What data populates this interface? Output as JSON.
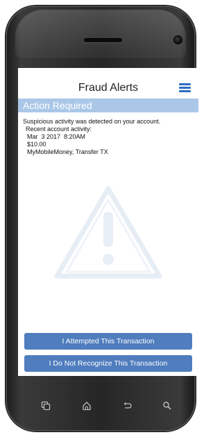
{
  "header": {
    "title": "Fraud Alerts",
    "menu_icon": "hamburger-menu-icon"
  },
  "banner": {
    "text": "Action Required"
  },
  "message": {
    "intro": "Suspicious activity was detected on your account.",
    "activity_label": "Recent account activity:",
    "date_time": "Mar  3 2017  8:20AM",
    "amount": "$10.00",
    "merchant": "MyMobileMoney, Transfer TX"
  },
  "actions": {
    "attempted_label": "I Attempted This Transaction",
    "not_recognize_label": "I Do Not Recognize This Transaction"
  },
  "device_nav": {
    "icons": [
      "recent-apps-icon",
      "home-icon",
      "back-icon",
      "search-icon"
    ]
  },
  "colors": {
    "accent_blue": "#4f7dbe",
    "banner_blue": "#aac7e8",
    "menu_blue": "#2f6cc2"
  }
}
